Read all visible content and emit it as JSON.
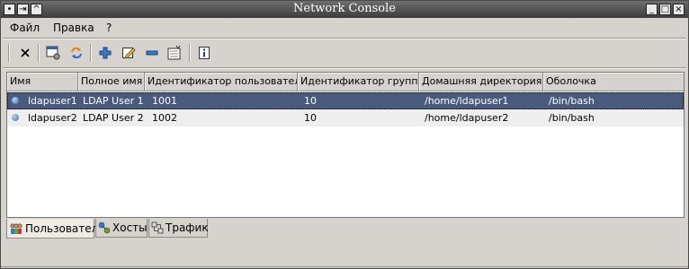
{
  "window": {
    "title": "Network Console",
    "buttons": {
      "minimize": "_",
      "maximize": "□",
      "close": "×"
    },
    "left_buttons": {
      "pin": "•",
      "collapse": "⇥",
      "roll": "^"
    }
  },
  "menubar": {
    "items": [
      {
        "label": "Файл"
      },
      {
        "label": "Правка"
      },
      {
        "label": "?"
      }
    ]
  },
  "toolbar": {
    "icons": [
      "close-icon",
      "config-icon",
      "refresh-icon",
      "add-icon",
      "edit-icon",
      "remove-icon",
      "properties-icon",
      "info-icon"
    ]
  },
  "table": {
    "columns": [
      "Имя",
      "Полное имя",
      "Идентификатор пользователя",
      "Идентификатор группы",
      "Домашняя директория",
      "Оболочка"
    ],
    "rows": [
      {
        "name": "ldapuser1",
        "fullname": "LDAP User 1",
        "uid": "1001",
        "gid": "10",
        "home": "/home/ldapuser1",
        "shell": "/bin/bash",
        "selected": true
      },
      {
        "name": "ldapuser2",
        "fullname": "LDAP User 2",
        "uid": "1002",
        "gid": "10",
        "home": "/home/ldapuser2",
        "shell": "/bin/bash",
        "selected": false
      }
    ]
  },
  "tabs": [
    {
      "label": "Пользователи",
      "active": true
    },
    {
      "label": "Хосты",
      "active": false
    },
    {
      "label": "Трафик",
      "active": false
    }
  ],
  "colors": {
    "selection": "#4a5a7c",
    "titlebar": "#505050",
    "background": "#d6d3ce"
  }
}
